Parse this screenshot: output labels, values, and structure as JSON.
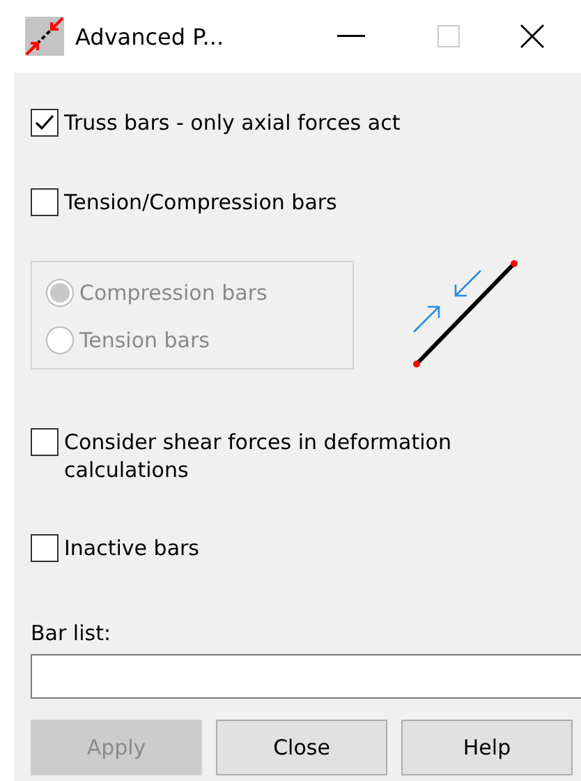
{
  "window": {
    "title": "Advanced P..."
  },
  "options": [
    {
      "kind": "checkbox",
      "label": "Truss bars - only axial forces act",
      "checked": true
    },
    {
      "kind": "checkbox",
      "label": "Tension/Compression bars",
      "checked": false
    }
  ],
  "bar_type": {
    "disabled": true,
    "options": [
      {
        "label": "Compression bars",
        "selected": true
      },
      {
        "label": "Tension bars",
        "selected": false
      }
    ]
  },
  "more_options": [
    {
      "label": "Consider shear forces in deformation calculations",
      "checked": false
    },
    {
      "label": "Inactive bars",
      "checked": false
    }
  ],
  "bar_list": {
    "label": "Bar list:"
  },
  "buttons": [
    {
      "label": "Apply",
      "disabled": true
    },
    {
      "label": "Close",
      "disabled": false
    },
    {
      "label": "Help",
      "disabled": false
    }
  ]
}
